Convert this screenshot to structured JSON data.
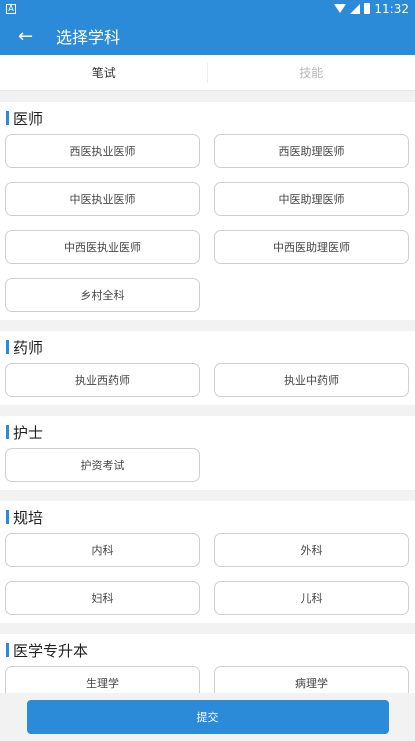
{
  "status": {
    "time": "11:32",
    "left_icon": "notification-icon"
  },
  "appbar": {
    "back_icon": "←",
    "title": "选择学科"
  },
  "tabs": [
    {
      "label": "笔试",
      "active": true
    },
    {
      "label": "技能",
      "active": false
    }
  ],
  "sections": [
    {
      "title": "医师",
      "items": [
        "西医执业医师",
        "西医助理医师",
        "中医执业医师",
        "中医助理医师",
        "中西医执业医师",
        "中西医助理医师",
        "乡村全科"
      ]
    },
    {
      "title": "药师",
      "items": [
        "执业西药师",
        "执业中药师"
      ]
    },
    {
      "title": "护士",
      "items": [
        "护资考试"
      ]
    },
    {
      "title": "规培",
      "items": [
        "内科",
        "外科",
        "妇科",
        "儿科"
      ]
    },
    {
      "title": "医学专升本",
      "items": [
        "生理学",
        "病理学"
      ]
    }
  ],
  "submit_label": "提交",
  "colors": {
    "primary": "#2b8bd8",
    "background": "#f2f2f2"
  }
}
